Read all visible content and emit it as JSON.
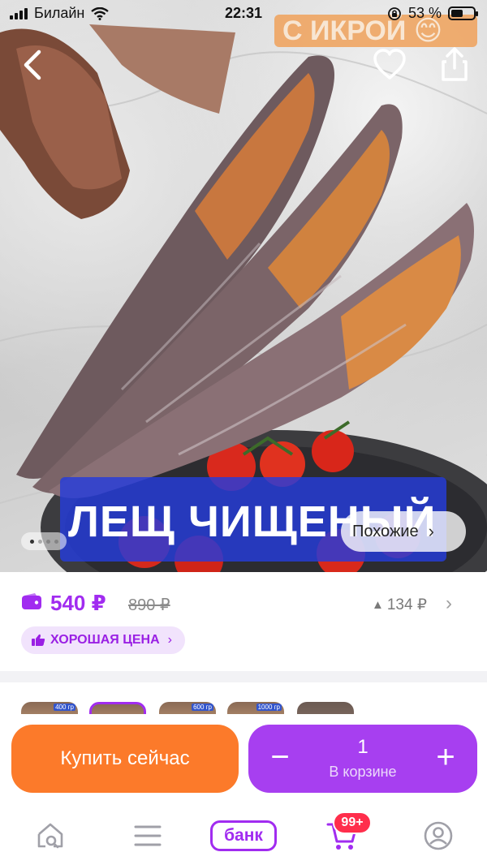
{
  "status_bar": {
    "carrier": "Билайн",
    "time": "22:31",
    "battery_percent": "53 %",
    "battery_level": 0.53
  },
  "photo": {
    "overlay_top_text": "С ИКРОЙ 😊",
    "banner_text": "ЛЕЩ ЧИЩЕНЫЙ",
    "similar_label": "Похожие",
    "slides_total": 4,
    "slide_active": 1
  },
  "price": {
    "current": "540 ₽",
    "old": "890 ₽",
    "drop": "134 ₽",
    "badge": "ХОРОШАЯ ЦЕНА"
  },
  "variants": {
    "labels": [
      "400 гр",
      "",
      "600 гр",
      "1000 гр",
      ""
    ]
  },
  "actions": {
    "buy_label": "Купить сейчас",
    "cart_qty": "1",
    "cart_label": "В корзине"
  },
  "nav": {
    "bank_label": "банк",
    "cart_badge": "99+"
  },
  "colors": {
    "accent": "#a12cf0",
    "buy": "#fc7a2a",
    "stepper": "#a73ff0",
    "badge": "#ff2e4c"
  }
}
